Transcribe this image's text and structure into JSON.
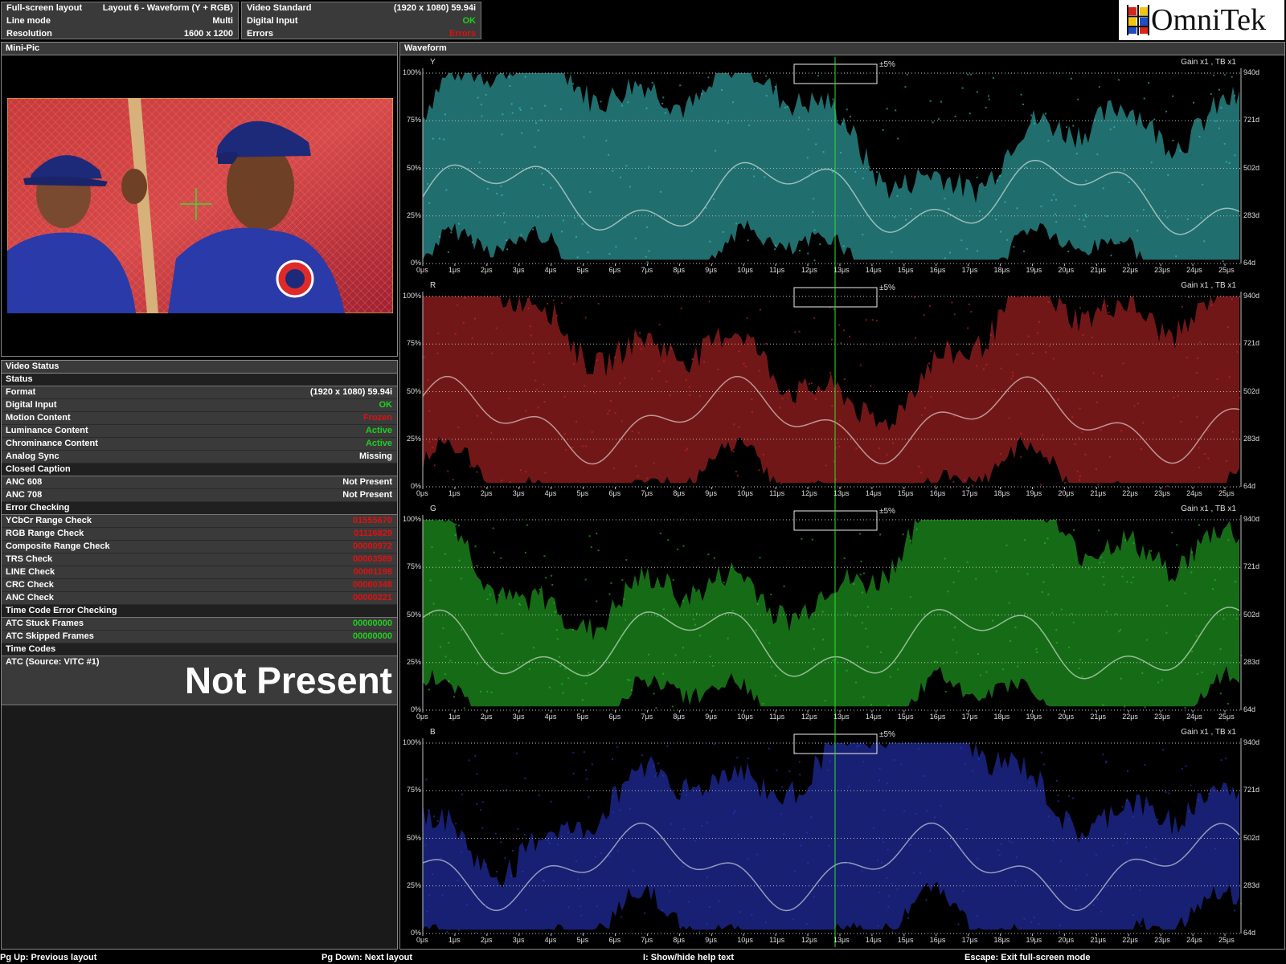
{
  "header": {
    "layout_box": {
      "rows": [
        {
          "label": "Full-screen layout",
          "value": "Layout 6 - Waveform (Y + RGB)"
        },
        {
          "label": "Line mode",
          "value": "Multi"
        },
        {
          "label": "Resolution",
          "value": "1600 x 1200"
        }
      ]
    },
    "video_box": {
      "rows": [
        {
          "label": "Video Standard",
          "value": "(1920 x 1080) 59.94i",
          "status": "normal"
        },
        {
          "label": "Digital Input",
          "value": "OK",
          "status": "ok"
        },
        {
          "label": "Errors",
          "value": "Errors",
          "status": "error"
        }
      ]
    },
    "logo": {
      "text": "OmniTek"
    }
  },
  "minipic": {
    "title": "Mini-Pic"
  },
  "video_status": {
    "title": "Video Status",
    "sections": [
      {
        "heading": "Status",
        "rows": [
          {
            "label": "Format",
            "value": "(1920 x 1080) 59.94i",
            "status": "normal"
          },
          {
            "label": "Digital Input",
            "value": "OK",
            "status": "ok"
          },
          {
            "label": "Motion Content",
            "value": "Frozen",
            "status": "error"
          },
          {
            "label": "Luminance Content",
            "value": "Active",
            "status": "ok"
          },
          {
            "label": "Chrominance Content",
            "value": "Active",
            "status": "ok"
          },
          {
            "label": "Analog Sync",
            "value": "Missing",
            "status": "normal"
          }
        ]
      },
      {
        "heading": "Closed Caption",
        "rows": [
          {
            "label": "ANC 608",
            "value": "Not Present",
            "status": "normal"
          },
          {
            "label": "ANC 708",
            "value": "Not Present",
            "status": "normal"
          }
        ]
      },
      {
        "heading": "Error Checking",
        "rows": [
          {
            "label": "YCbCr Range Check",
            "value": "01555670",
            "status": "error"
          },
          {
            "label": "RGB Range Check",
            "value": "01116829",
            "status": "error"
          },
          {
            "label": "Composite Range Check",
            "value": "00000972",
            "status": "error"
          },
          {
            "label": "TRS Check",
            "value": "00003589",
            "status": "error"
          },
          {
            "label": "LINE Check",
            "value": "00001198",
            "status": "error"
          },
          {
            "label": "CRC Check",
            "value": "00000348",
            "status": "error"
          },
          {
            "label": "ANC Check",
            "value": "00000221",
            "status": "error"
          }
        ]
      },
      {
        "heading": "Time Code Error Checking",
        "rows": [
          {
            "label": "ATC Stuck Frames",
            "value": "00000000",
            "status": "ok"
          },
          {
            "label": "ATC Skipped Frames",
            "value": "00000000",
            "status": "ok"
          }
        ]
      },
      {
        "heading": "Time Codes",
        "rows": []
      }
    ],
    "timecode_source": "ATC (Source: VITC #1)",
    "timecode_value": "Not Present"
  },
  "waveform": {
    "title": "Waveform",
    "gain_label": "Gain x1 , TB x1",
    "window_label": "±5%",
    "y_ticks": [
      "100%",
      "75%",
      "50%",
      "25%",
      "0%"
    ],
    "right_ticks": [
      "940d",
      "721d",
      "502d",
      "283d",
      "64d"
    ],
    "x_ticks": [
      "0μs",
      "1μs",
      "2μs",
      "3μs",
      "4μs",
      "5μs",
      "6μs",
      "7μs",
      "8μs",
      "9μs",
      "10μs",
      "11μs",
      "12μs",
      "13μs",
      "14μs",
      "15μs",
      "16μs",
      "17μs",
      "18μs",
      "19μs",
      "20μs",
      "21μs",
      "22μs",
      "23μs",
      "24μs",
      "25μs"
    ],
    "channels": [
      {
        "name": "Y",
        "color": "#3cc8c8"
      },
      {
        "name": "R",
        "color": "#d02a2a"
      },
      {
        "name": "G",
        "color": "#28c428"
      },
      {
        "name": "B",
        "color": "#2a3ad0"
      }
    ]
  },
  "footer": {
    "items": [
      "Pg Up: Previous layout",
      "Pg Down: Next layout",
      "I: Show/hide help text",
      "Escape: Exit full-screen mode"
    ]
  }
}
